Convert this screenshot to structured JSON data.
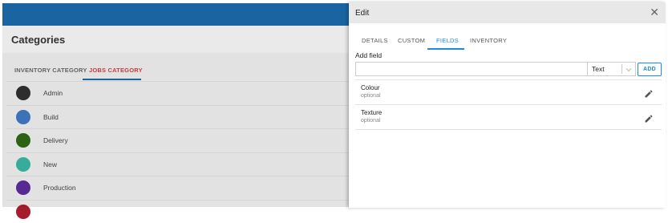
{
  "background": {
    "title": "Categories",
    "tabs": [
      {
        "label": "INVENTORY CATEGORY"
      },
      {
        "label": "JOBS CATEGORY"
      }
    ],
    "items": [
      {
        "label": "Admin",
        "color": "#2f2f2f"
      },
      {
        "label": "Build",
        "color": "#3f78c0"
      },
      {
        "label": "Delivery",
        "color": "#2e6612"
      },
      {
        "label": "New",
        "color": "#3ab5a0"
      },
      {
        "label": "Production",
        "color": "#5b2b9a"
      },
      {
        "label": "",
        "color": "#a51c2c"
      }
    ]
  },
  "panel": {
    "title": "Edit",
    "tabs": [
      {
        "label": "DETAILS"
      },
      {
        "label": "CUSTOM"
      },
      {
        "label": "FIELDS"
      },
      {
        "label": "INVENTORY"
      }
    ],
    "active_tab": "FIELDS",
    "add_field_label": "Add field",
    "field_input_value": "",
    "type_select_value": "Text",
    "add_button_label": "ADD",
    "fields": [
      {
        "name": "Colour",
        "status": "optional"
      },
      {
        "name": "Texture",
        "status": "optional"
      }
    ]
  },
  "colors": {
    "accent": "#1e88e5",
    "topbar": "#1c6aa8",
    "active_category_tab": "#d23f3f"
  }
}
